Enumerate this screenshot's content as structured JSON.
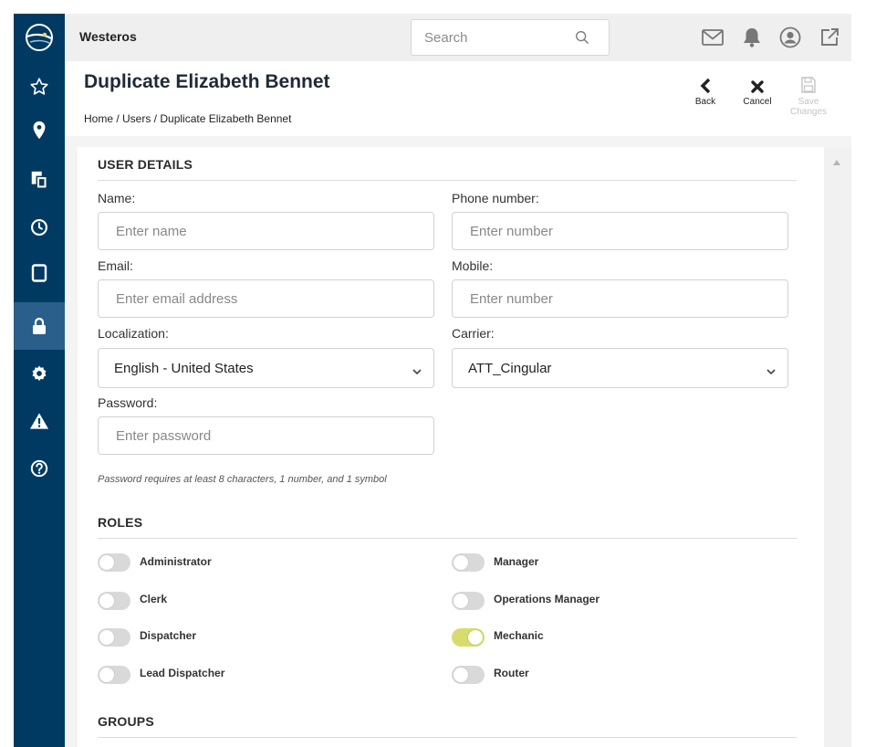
{
  "topbar": {
    "app_name": "Westeros",
    "search_placeholder": "Search"
  },
  "sidebar": {
    "items": [
      {
        "icon": "logo-icon"
      },
      {
        "icon": "star-icon"
      },
      {
        "icon": "location-pin-icon"
      },
      {
        "icon": "documents-icon"
      },
      {
        "icon": "clock-icon"
      },
      {
        "icon": "tablet-icon"
      },
      {
        "icon": "lock-icon",
        "active": true
      },
      {
        "icon": "gear-icon"
      },
      {
        "icon": "warning-icon"
      },
      {
        "icon": "help-icon"
      }
    ]
  },
  "header": {
    "title": "Duplicate Elizabeth Bennet",
    "breadcrumb": "Home / Users / Duplicate Elizabeth Bennet",
    "back_label": "Back",
    "cancel_label": "Cancel",
    "save_label": "Save Changes"
  },
  "user_details": {
    "section_title": "USER DETAILS",
    "name_label": "Name:",
    "name_placeholder": "Enter name",
    "phone_label": "Phone number:",
    "phone_placeholder": "Enter number",
    "email_label": "Email:",
    "email_placeholder": "Enter email address",
    "mobile_label": "Mobile:",
    "mobile_placeholder": "Enter number",
    "localization_label": "Localization:",
    "localization_value": "English - United States",
    "carrier_label": "Carrier:",
    "carrier_value": "ATT_Cingular",
    "password_label": "Password:",
    "password_placeholder": "Enter password",
    "password_hint": "Password requires at least 8 characters, 1 number, and 1 symbol"
  },
  "roles": {
    "section_title": "ROLES",
    "items": [
      {
        "label": "Administrator",
        "enabled": false
      },
      {
        "label": "Manager",
        "enabled": false
      },
      {
        "label": "Clerk",
        "enabled": false
      },
      {
        "label": "Operations Manager",
        "enabled": false
      },
      {
        "label": "Dispatcher",
        "enabled": false
      },
      {
        "label": "Mechanic",
        "enabled": true
      },
      {
        "label": "Lead Dispatcher",
        "enabled": false
      },
      {
        "label": "Router",
        "enabled": false
      }
    ]
  },
  "groups": {
    "section_title": "GROUPS"
  },
  "colors": {
    "sidebar": "#003a63",
    "sidebar_active": "#2a5f8c",
    "toggle_on": "#d7dc6e",
    "toggle_off": "#d9d9d9"
  }
}
